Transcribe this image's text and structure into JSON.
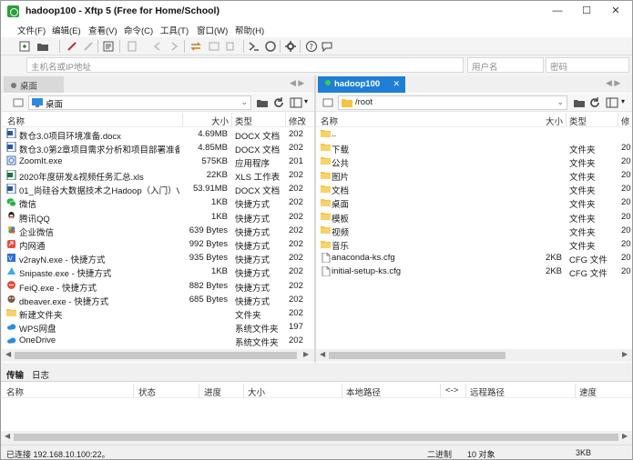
{
  "window": {
    "title": "hadoop100 - Xftp 5 (Free for Home/School)",
    "controls": {
      "minimize": "—",
      "maximize": "☐",
      "close": "✕"
    }
  },
  "menu": [
    "文件(F)",
    "编辑(E)",
    "查看(V)",
    "命令(C)",
    "工具(T)",
    "窗口(W)",
    "帮助(H)"
  ],
  "address_bar": {
    "host_placeholder": "主机名或IP地址",
    "username_placeholder": "用户名",
    "password_placeholder": "密码"
  },
  "left_pane": {
    "tab_label": "桌面",
    "path": "桌面",
    "columns": [
      "名称",
      "大小",
      "类型",
      "修改"
    ],
    "files": [
      {
        "name": "数仓3.0项目环境准备.docx",
        "size": "4.69MB",
        "type": "DOCX 文档",
        "modified": "202",
        "icon": "docx-icon"
      },
      {
        "name": "数仓3.0第2章项目需求分析和项目部署准备...",
        "size": "4.85MB",
        "type": "DOCX 文档",
        "modified": "202",
        "icon": "docx-icon"
      },
      {
        "name": "ZoomIt.exe",
        "size": "575KB",
        "type": "应用程序",
        "modified": "201",
        "icon": "exe-icon"
      },
      {
        "name": "2020年度研发&视频任务汇总.xls",
        "size": "22KB",
        "type": "XLS 工作表",
        "modified": "202",
        "icon": "xls-icon"
      },
      {
        "name": "01_尚硅谷大数据技术之Hadoop（入门）V...",
        "size": "53.91MB",
        "type": "DOCX 文档",
        "modified": "202",
        "icon": "docx-icon"
      },
      {
        "name": "微信",
        "size": "1KB",
        "type": "快捷方式",
        "modified": "202",
        "icon": "wechat-icon"
      },
      {
        "name": "腾讯QQ",
        "size": "1KB",
        "type": "快捷方式",
        "modified": "202",
        "icon": "qq-icon"
      },
      {
        "name": "企业微信",
        "size": "639 Bytes",
        "type": "快捷方式",
        "modified": "202",
        "icon": "wecom-icon"
      },
      {
        "name": "内网通",
        "size": "992 Bytes",
        "type": "快捷方式",
        "modified": "202",
        "icon": "shortcut-icon"
      },
      {
        "name": "v2rayN.exe - 快捷方式",
        "size": "935 Bytes",
        "type": "快捷方式",
        "modified": "202",
        "icon": "v2ray-icon"
      },
      {
        "name": "Snipaste.exe - 快捷方式",
        "size": "1KB",
        "type": "快捷方式",
        "modified": "202",
        "icon": "snipaste-icon"
      },
      {
        "name": "FeiQ.exe - 快捷方式",
        "size": "882 Bytes",
        "type": "快捷方式",
        "modified": "202",
        "icon": "feiq-icon"
      },
      {
        "name": "dbeaver.exe - 快捷方式",
        "size": "685 Bytes",
        "type": "快捷方式",
        "modified": "202",
        "icon": "dbeaver-icon"
      },
      {
        "name": "新建文件夹",
        "size": "",
        "type": "文件夹",
        "modified": "202",
        "icon": "folder-icon"
      },
      {
        "name": "WPS网盘",
        "size": "",
        "type": "系统文件夹",
        "modified": "197",
        "icon": "cloud-icon"
      },
      {
        "name": "OneDrive",
        "size": "",
        "type": "系统文件夹",
        "modified": "202",
        "icon": "cloud-icon"
      }
    ]
  },
  "right_pane": {
    "tab_label": "hadoop100",
    "path": "/root",
    "columns": [
      "名称",
      "大小",
      "类型",
      "修"
    ],
    "files": [
      {
        "name": "..",
        "size": "",
        "type": "",
        "modified": "",
        "icon": "folder-icon"
      },
      {
        "name": "下载",
        "size": "",
        "type": "文件夹",
        "modified": "20",
        "icon": "folder-icon"
      },
      {
        "name": "公共",
        "size": "",
        "type": "文件夹",
        "modified": "20",
        "icon": "folder-icon"
      },
      {
        "name": "图片",
        "size": "",
        "type": "文件夹",
        "modified": "20",
        "icon": "folder-icon"
      },
      {
        "name": "文档",
        "size": "",
        "type": "文件夹",
        "modified": "20",
        "icon": "folder-icon"
      },
      {
        "name": "桌面",
        "size": "",
        "type": "文件夹",
        "modified": "20",
        "icon": "folder-icon"
      },
      {
        "name": "模板",
        "size": "",
        "type": "文件夹",
        "modified": "20",
        "icon": "folder-icon"
      },
      {
        "name": "视频",
        "size": "",
        "type": "文件夹",
        "modified": "20",
        "icon": "folder-icon"
      },
      {
        "name": "音乐",
        "size": "",
        "type": "文件夹",
        "modified": "20",
        "icon": "folder-icon"
      },
      {
        "name": "anaconda-ks.cfg",
        "size": "2KB",
        "type": "CFG 文件",
        "modified": "20",
        "icon": "file-icon"
      },
      {
        "name": "initial-setup-ks.cfg",
        "size": "2KB",
        "type": "CFG 文件",
        "modified": "20",
        "icon": "file-icon"
      }
    ]
  },
  "transfer": {
    "tabs": [
      "传输",
      "日志"
    ],
    "columns": [
      "名称",
      "状态",
      "进度",
      "大小",
      "本地路径",
      "<->",
      "远程路径",
      "速度"
    ]
  },
  "status": {
    "connection": "已连接 192.168.10.100:22。",
    "mode": "二进制",
    "objects": "10 对象",
    "size": "3KB"
  },
  "colors": {
    "accent": "#1f7fd6",
    "folder": "#f5c542",
    "docx": "#2b579a",
    "xls": "#1e7145"
  }
}
